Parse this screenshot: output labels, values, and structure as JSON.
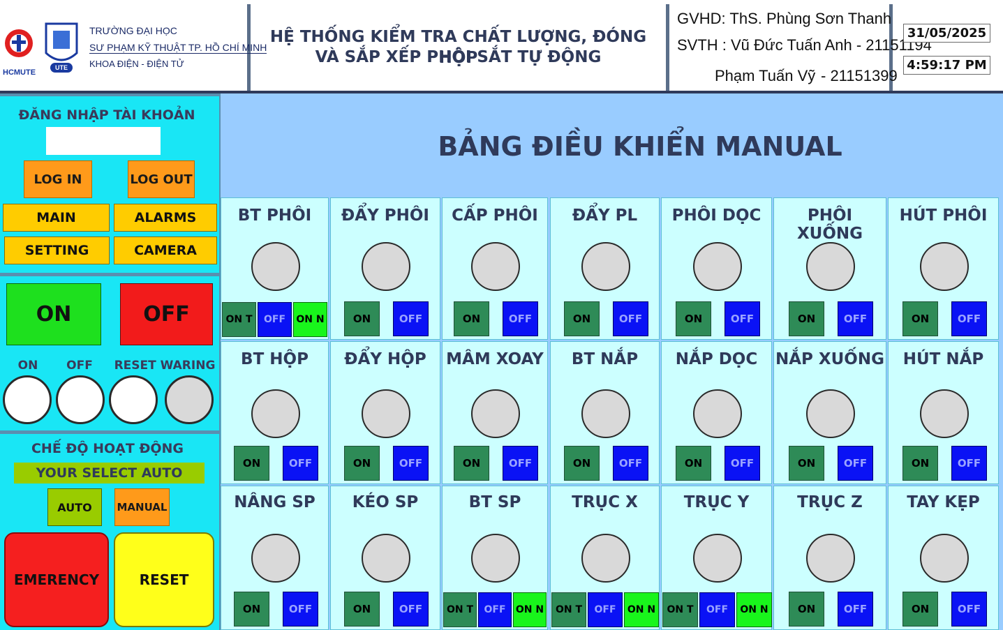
{
  "header": {
    "logo_hcmute": "HCMUTE",
    "logo_ute": "UTE",
    "school_line1": "TRƯỜNG ĐẠI HỌC",
    "school_line2": "SƯ PHẠM KỸ THUẬT TP. HỒ CHÍ MINH",
    "school_line3": "KHOA ĐIỆN - ĐIỆN TỬ",
    "title_line1": "HỆ THỐNG KIỂM TRA CHẤT LƯỢNG, ĐÓNG HỘP",
    "title_line2": "VÀ SẮP XẾP PHÔI SẮT TỰ ĐỘNG",
    "gvhd": "GVHD: ThS. Phùng Sơn Thanh",
    "svth1": "SVTH : Vũ Đức Tuấn Anh - 21151194",
    "svth2_name": "Phạm Tuấn Vỹ",
    "svth2_id": "- 21151399",
    "date": "31/05/2025",
    "time": "4:59:17 PM"
  },
  "left": {
    "login_title": "ĐĂNG NHẬP TÀI KHOẢN",
    "login_input_value": "",
    "log_in": "LOG IN",
    "log_out": "LOG OUT",
    "main": "MAIN",
    "alarms": "ALARMS",
    "setting": "SETTING",
    "camera": "CAMERA",
    "on": "ON",
    "off": "OFF",
    "lamp_on": "ON",
    "lamp_off": "OFF",
    "lamp_reset_warning": "RESET WARING",
    "mode_title": "CHẾ ĐỘ HOẠT ĐỘNG",
    "mode_status": "YOUR SELECT AUTO",
    "auto": "AUTO",
    "manual": "MANUAL",
    "emergency": "EMERENCY",
    "reset": "RESET"
  },
  "panel_title": "BẢNG ĐIỀU KHIỂN MANUAL",
  "cells": [
    {
      "title": "BT PHÔI",
      "buttons": [
        "ON T",
        "OFF",
        "ON N"
      ]
    },
    {
      "title": "ĐẨY PHÔI",
      "buttons": [
        "ON",
        "OFF"
      ]
    },
    {
      "title": "CẤP PHÔI",
      "buttons": [
        "ON",
        "OFF"
      ]
    },
    {
      "title": "ĐẨY PL",
      "buttons": [
        "ON",
        "OFF"
      ]
    },
    {
      "title": "PHÔI DỌC",
      "buttons": [
        "ON",
        "OFF"
      ]
    },
    {
      "title": "PHÔI XUỐNG",
      "buttons": [
        "ON",
        "OFF"
      ]
    },
    {
      "title": "HÚT PHÔI",
      "buttons": [
        "ON",
        "OFF"
      ]
    },
    {
      "title": "BT HỘP",
      "buttons": [
        "ON",
        "OFF"
      ]
    },
    {
      "title": "ĐẨY HỘP",
      "buttons": [
        "ON",
        "OFF"
      ]
    },
    {
      "title": "MÂM XOAY",
      "buttons": [
        "ON",
        "OFF"
      ]
    },
    {
      "title": "BT NẮP",
      "buttons": [
        "ON",
        "OFF"
      ]
    },
    {
      "title": "NẮP DỌC",
      "buttons": [
        "ON",
        "OFF"
      ]
    },
    {
      "title": "NẮP XUỐNG",
      "buttons": [
        "ON",
        "OFF"
      ]
    },
    {
      "title": "HÚT NẮP",
      "buttons": [
        "ON",
        "OFF"
      ]
    },
    {
      "title": "NÂNG SP",
      "buttons": [
        "ON",
        "OFF"
      ]
    },
    {
      "title": "KÉO SP",
      "buttons": [
        "ON",
        "OFF"
      ]
    },
    {
      "title": "BT SP",
      "buttons": [
        "ON T",
        "OFF",
        "ON N"
      ]
    },
    {
      "title": "TRỤC X",
      "buttons": [
        "ON T",
        "OFF",
        "ON N"
      ]
    },
    {
      "title": "TRỤC Y",
      "buttons": [
        "ON T",
        "OFF",
        "ON N"
      ]
    },
    {
      "title": "TRỤC Z",
      "buttons": [
        "ON",
        "OFF"
      ]
    },
    {
      "title": "TAY KẸP",
      "buttons": [
        "ON",
        "OFF"
      ]
    }
  ],
  "colors": {
    "cyan_panel": "#19e6f5",
    "main_bg": "#99ccff",
    "cell_bg": "#ccffff",
    "on_green": "#2e8b57",
    "off_blue": "#0a12f5",
    "on_lime": "#19f51c",
    "emergency_red": "#f51f1f",
    "reset_yellow": "#ffff1a"
  }
}
